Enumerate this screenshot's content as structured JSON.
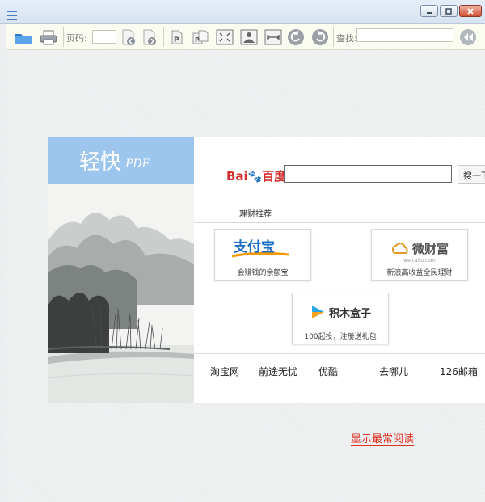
{
  "toolbar": {
    "page_label": "页码:",
    "page_value": "",
    "find_label": "查找:",
    "find_value": ""
  },
  "brand": {
    "name": "轻快",
    "suffix": "PDF"
  },
  "baidu": {
    "logo_text_a": "Bai",
    "logo_text_b": "百度",
    "search_value": "",
    "search_button": "搜一下"
  },
  "finance": {
    "section_label": "理财推荐",
    "cards": [
      {
        "logo": "支付宝",
        "desc": "会赚钱的余额宝"
      },
      {
        "logo": "微财富",
        "sub": "weicaifu.com",
        "desc": "新浪高收益全民理财"
      },
      {
        "logo": "积木盒子",
        "desc": "100起投，注册送礼包"
      }
    ]
  },
  "links": [
    "淘宝网",
    "前途无忧",
    "优酷",
    "去哪儿",
    "126邮箱"
  ],
  "read_mode_link": "显示最常阅读",
  "colors": {
    "brand_blue": "#9dc6ee",
    "alipay_blue": "#1a6fc4",
    "alipay_orange": "#f39800",
    "link_red": "#e03020"
  }
}
